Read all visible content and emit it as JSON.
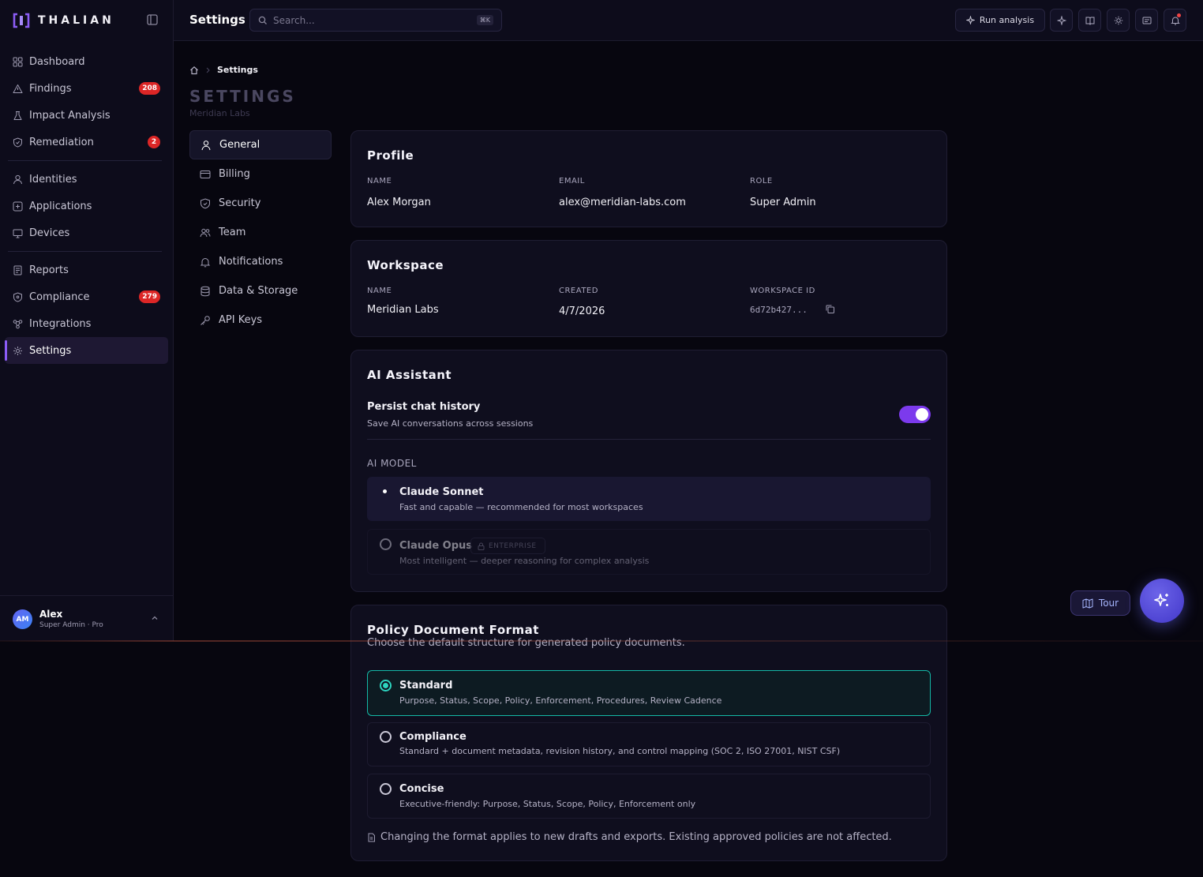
{
  "brand": {
    "name": "THALIAN",
    "accent": "#8b5cf6"
  },
  "sidebar": {
    "groups": [
      [
        {
          "label": "Dashboard",
          "icon": "grid-icon"
        },
        {
          "label": "Findings",
          "icon": "alert-triangle-icon",
          "badge": "208"
        },
        {
          "label": "Impact Analysis",
          "icon": "flask-icon"
        },
        {
          "label": "Remediation",
          "icon": "shield-check-icon",
          "badge": "2"
        }
      ],
      [
        {
          "label": "Identities",
          "icon": "user-icon"
        },
        {
          "label": "Applications",
          "icon": "plus-square-icon"
        },
        {
          "label": "Devices",
          "icon": "monitor-icon"
        }
      ],
      [
        {
          "label": "Reports",
          "icon": "document-icon"
        },
        {
          "label": "Compliance",
          "icon": "shield-icon",
          "badge": "279"
        },
        {
          "label": "Integrations",
          "icon": "nodes-icon"
        },
        {
          "label": "Settings",
          "icon": "gear-icon",
          "active": true
        }
      ]
    ],
    "user": {
      "initials": "AM",
      "name": "Alex",
      "role": "Super Admin · Pro"
    }
  },
  "topbar": {
    "title": "Settings",
    "search_placeholder": "Search...",
    "search_shortcut": "⌘K",
    "run_label": "Run analysis"
  },
  "breadcrumb": {
    "current": "Settings"
  },
  "page": {
    "title": "SETTINGS",
    "subtitle": "Meridian Labs"
  },
  "subnav": [
    {
      "label": "General",
      "icon": "user-icon",
      "active": true
    },
    {
      "label": "Billing",
      "icon": "credit-card-icon"
    },
    {
      "label": "Security",
      "icon": "shield-icon"
    },
    {
      "label": "Team",
      "icon": "users-icon"
    },
    {
      "label": "Notifications",
      "icon": "bell-icon"
    },
    {
      "label": "Data & Storage",
      "icon": "database-icon"
    },
    {
      "label": "API Keys",
      "icon": "key-icon"
    }
  ],
  "profile": {
    "title": "Profile",
    "name_label": "NAME",
    "name": "Alex Morgan",
    "email_label": "EMAIL",
    "email": "alex@meridian-labs.com",
    "role_label": "ROLE",
    "role": "Super Admin"
  },
  "workspace": {
    "title": "Workspace",
    "name_label": "NAME",
    "name": "Meridian Labs",
    "created_label": "CREATED",
    "created": "4/7/2026",
    "id_label": "WORKSPACE ID",
    "id": "6d72b427..."
  },
  "ai": {
    "title": "AI Assistant",
    "persist_title": "Persist chat history",
    "persist_desc": "Save AI conversations across sessions",
    "persist_on": true,
    "model_label": "AI MODEL",
    "models": [
      {
        "name": "Claude Sonnet",
        "desc": "Fast and capable — recommended for most workspaces",
        "selected": true
      },
      {
        "name": "Claude Opus",
        "desc": "Most intelligent — deeper reasoning for complex analysis",
        "badge": "ENTERPRISE",
        "locked": true
      }
    ]
  },
  "policy": {
    "title": "Policy Document Format",
    "subtitle": "Choose the default structure for generated policy documents.",
    "options": [
      {
        "name": "Standard",
        "desc": "Purpose, Status, Scope, Policy, Enforcement, Procedures, Review Cadence",
        "selected": true
      },
      {
        "name": "Compliance",
        "desc": "Standard + document metadata, revision history, and control mapping (SOC 2, ISO 27001, NIST CSF)"
      },
      {
        "name": "Concise",
        "desc": "Executive-friendly: Purpose, Status, Scope, Policy, Enforcement only"
      }
    ],
    "footnote": "Changing the format applies to new drafts and exports. Existing approved policies are not affected."
  },
  "floating": {
    "tour_label": "Tour"
  }
}
